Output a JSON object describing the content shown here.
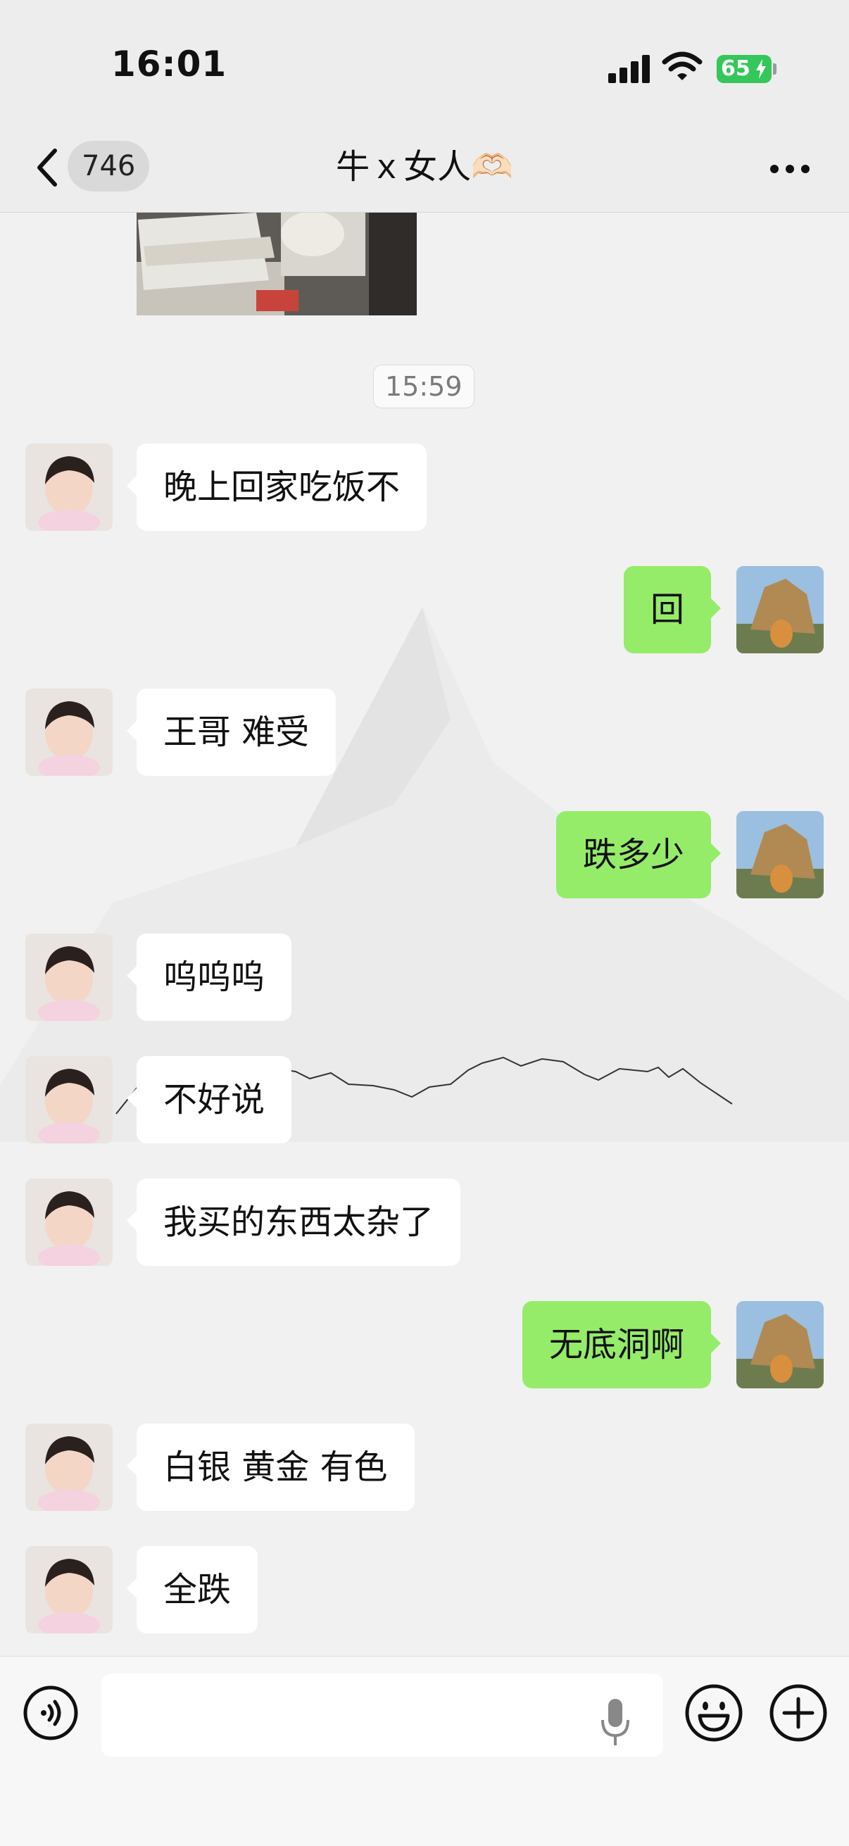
{
  "status_bar": {
    "time": "16:01",
    "battery": "65"
  },
  "nav": {
    "unread_count": "746",
    "title": "牛ｘ女人🫶🏻"
  },
  "chat": {
    "timestamp": "15:59",
    "messages": [
      {
        "direction": "in",
        "text": "晚上回家吃饭不"
      },
      {
        "direction": "out",
        "text": "回"
      },
      {
        "direction": "in",
        "text": "王哥 难受"
      },
      {
        "direction": "out",
        "text": "跌多少"
      },
      {
        "direction": "in",
        "text": "呜呜呜"
      },
      {
        "direction": "in",
        "text": "不好说"
      },
      {
        "direction": "in",
        "text": "我买的东西太杂了"
      },
      {
        "direction": "out",
        "text": "无底洞啊"
      },
      {
        "direction": "in",
        "text": "白银 黄金 有色"
      },
      {
        "direction": "in",
        "text": "全跌"
      }
    ]
  },
  "input": {
    "value": "",
    "placeholder": ""
  },
  "colors": {
    "outgoing_bubble": "#95ec69",
    "incoming_bubble": "#ffffff",
    "background": "#ededed",
    "battery": "#34c759"
  },
  "icons": [
    "back-icon",
    "more-icon",
    "voice-icon",
    "mic-icon",
    "emoji-icon",
    "plus-icon"
  ]
}
